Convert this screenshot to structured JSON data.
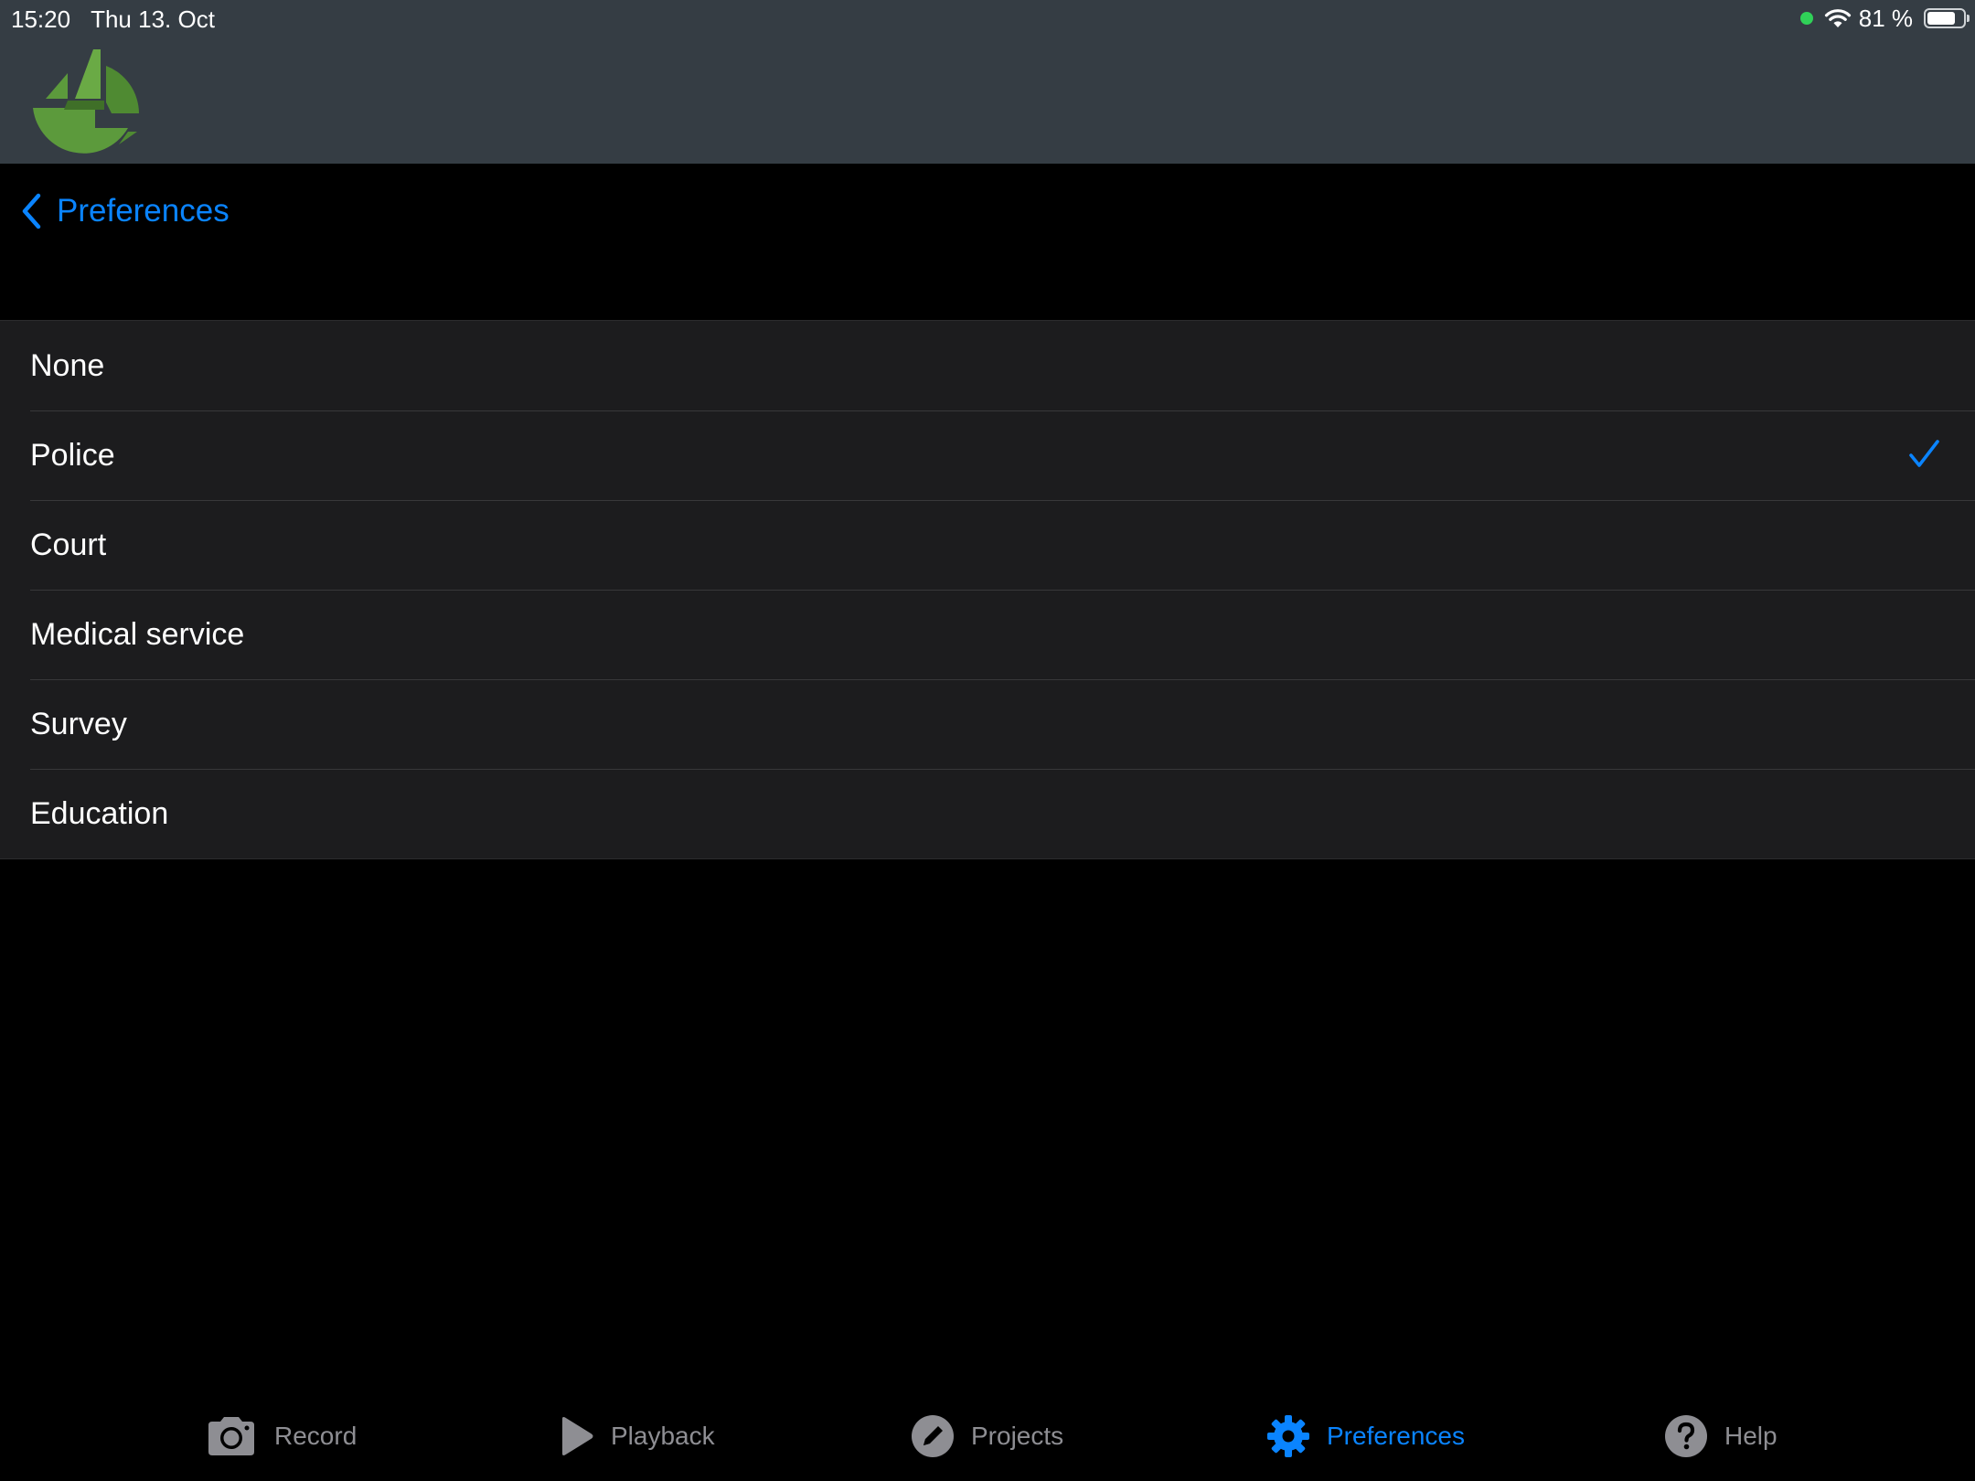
{
  "status_bar": {
    "time": "15:20",
    "date": "Thu 13. Oct",
    "battery_text": "81 %",
    "battery_level": 0.81
  },
  "nav": {
    "back_label": "Preferences"
  },
  "options": [
    {
      "label": "None",
      "selected": false
    },
    {
      "label": "Police",
      "selected": true
    },
    {
      "label": "Court",
      "selected": false
    },
    {
      "label": "Medical service",
      "selected": false
    },
    {
      "label": "Survey",
      "selected": false
    },
    {
      "label": "Education",
      "selected": false
    }
  ],
  "tabs": [
    {
      "label": "Record",
      "icon": "camera-icon",
      "active": false
    },
    {
      "label": "Playback",
      "icon": "play-icon",
      "active": false
    },
    {
      "label": "Projects",
      "icon": "pencil-icon",
      "active": false
    },
    {
      "label": "Preferences",
      "icon": "gear-icon",
      "active": true
    },
    {
      "label": "Help",
      "icon": "help-icon",
      "active": false
    }
  ],
  "colors": {
    "accent": "#0a84ff",
    "header_bg": "#353d44",
    "list_bg": "#1c1c1e",
    "inactive_tab": "#8e8e93",
    "logo_green": "#5c9a3c"
  }
}
